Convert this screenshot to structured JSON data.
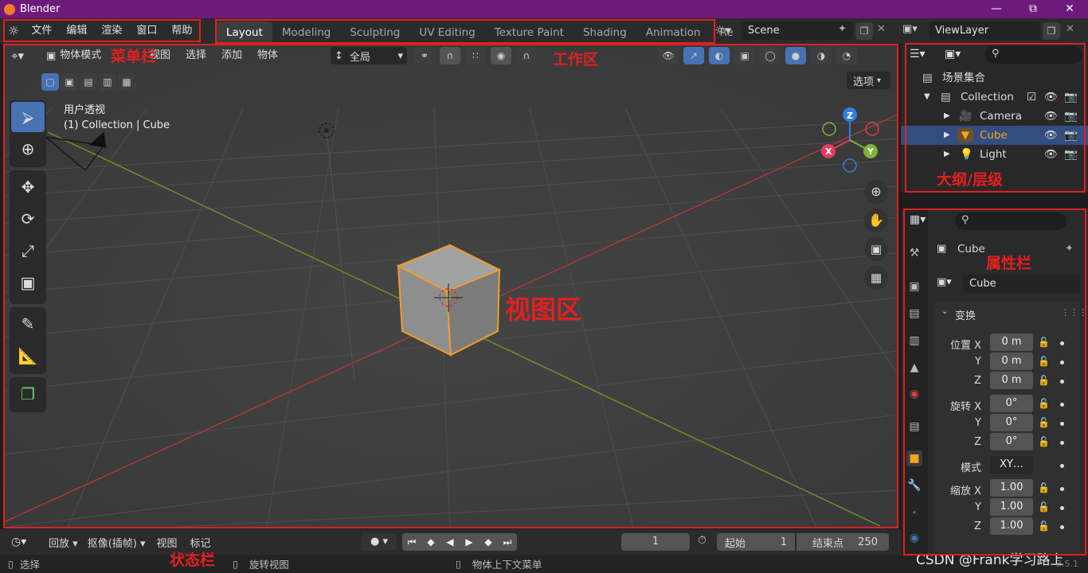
{
  "window": {
    "title": "Blender",
    "min": "—",
    "max": "⧉",
    "close": "✕"
  },
  "menu": [
    "文件",
    "编辑",
    "渲染",
    "窗口",
    "帮助"
  ],
  "workspace_tabs": [
    "Layout",
    "Modeling",
    "Sculpting",
    "UV Editing",
    "Texture Paint",
    "Shading",
    "Animation",
    "Re"
  ],
  "scene": {
    "name": "Scene"
  },
  "viewlayer": {
    "name": "ViewLayer"
  },
  "viewport": {
    "mode": "物体模式",
    "menus": [
      "视图",
      "选择",
      "添加",
      "物体"
    ],
    "orientation": "全局",
    "options": "选项",
    "perspective": "用户透视",
    "object_info": "(1) Collection | Cube",
    "gizmo": {
      "x": "X",
      "y": "Y",
      "z": "Z"
    }
  },
  "outliner": {
    "root": "场景集合",
    "collection": "Collection",
    "items": [
      "Camera",
      "Cube",
      "Light"
    ]
  },
  "properties": {
    "object_name": "Cube",
    "data_name": "Cube",
    "panel": "变换",
    "location_label": "位置 X",
    "rotation_label": "旋转 X",
    "scale_label": "缩放 X",
    "axis_y": "Y",
    "axis_z": "Z",
    "location": [
      "0 m",
      "0 m",
      "0 m"
    ],
    "rotation": [
      "0°",
      "0°",
      "0°"
    ],
    "mode_label": "模式",
    "mode_value": "XY…",
    "scale": [
      "1.00",
      "1.00",
      "1.00"
    ]
  },
  "timeline": {
    "menus": [
      "回放",
      "抠像(插帧)",
      "视图",
      "标记"
    ],
    "current_frame": "1",
    "start_label": "起始",
    "start": "1",
    "end_label": "结束点",
    "end": "250"
  },
  "statusbar": {
    "select": "选择",
    "rotate": "旋转视图",
    "context": "物体上下文菜单",
    "version": "3.5.1"
  },
  "annotations": {
    "menubar": "菜单栏",
    "workspace": "工作区",
    "viewport": "视图区",
    "outliner": "大纲/层级",
    "properties": "属性栏",
    "statusbar": "状态栏"
  },
  "watermark": "CSDN @Frank学习路上",
  "colors": {
    "accent": "#4772b3",
    "selection": "#f5a623",
    "annotation": "#e22020"
  }
}
